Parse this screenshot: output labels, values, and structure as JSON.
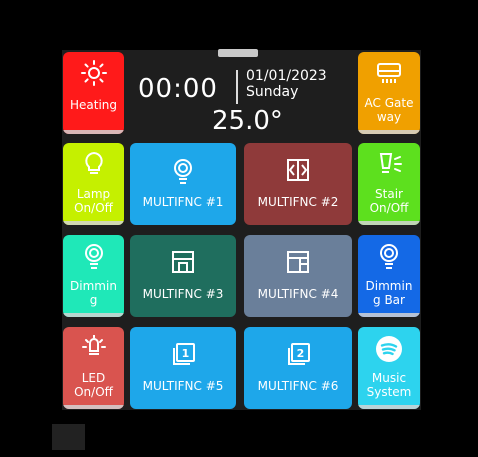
{
  "header": {
    "time": "00:00",
    "date": "01/01/2023",
    "day": "Sunday",
    "temperature": "25.0°"
  },
  "tiles": {
    "heating": {
      "label": "Heating",
      "color": "#ff1a1a",
      "icon": "sun-icon"
    },
    "ac_gateway": {
      "label": "AC Gate way",
      "color": "#f0a000",
      "icon": "ac-unit-icon"
    },
    "lamp": {
      "label": "Lamp On/Off",
      "color": "#c5f000",
      "icon": "lightbulb-icon"
    },
    "multifnc1": {
      "label": "MULTIFNC #1",
      "color": "#1ea7ea",
      "icon": "dimmer-bulb-icon"
    },
    "multifnc2": {
      "label": "MULTIFNC #2",
      "color": "#8f3a3a",
      "icon": "window-icon"
    },
    "stair": {
      "label": "Stair On/Off",
      "color": "#5de01e",
      "icon": "stair-light-icon"
    },
    "dimming": {
      "label": "Dimmin g",
      "color": "#1fe8b8",
      "icon": "dimmer-bulb-icon"
    },
    "multifnc3": {
      "label": "MULTIFNC #3",
      "color": "#1f6e5e",
      "icon": "shutter-icon"
    },
    "multifnc4": {
      "label": "MULTIFNC #4",
      "color": "#6a7f9a",
      "icon": "cabinet-icon"
    },
    "dimming_bar": {
      "label": "Dimmin g Bar",
      "color": "#1469e6",
      "icon": "dimmer-bulb-icon"
    },
    "led": {
      "label": "LED On/Off",
      "color": "#d9544f",
      "icon": "led-icon"
    },
    "multifnc5": {
      "label": "MULTIFNC #5",
      "color": "#1ea7ea",
      "icon": "scene-1-icon"
    },
    "multifnc6": {
      "label": "MULTIFNC #6",
      "color": "#1ea7ea",
      "icon": "scene-2-icon"
    },
    "music": {
      "label": "Music System",
      "color": "#2dd3ee",
      "icon": "spotify-icon"
    }
  }
}
